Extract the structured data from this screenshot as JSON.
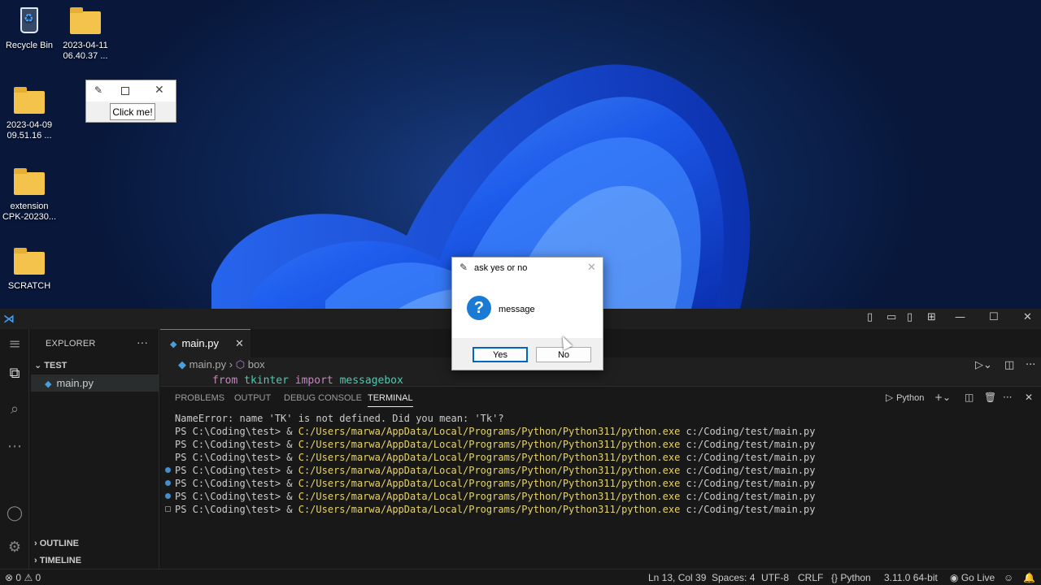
{
  "desktop": {
    "icons": [
      {
        "label": "Recycle Bin"
      },
      {
        "label": "2023-04-11 06.40.37 ..."
      },
      {
        "label": "2023-04-09 09.51.16 ..."
      },
      {
        "label": "extension CPK-20230..."
      },
      {
        "label": "SCRATCH"
      }
    ],
    "tk_window": {
      "button_label": "Click me!"
    }
  },
  "dialog": {
    "title": "ask yes or no",
    "message": "message",
    "yes_label": "Yes",
    "no_label": "No"
  },
  "vscode": {
    "sidebar": {
      "title": "EXPLORER",
      "folder": "TEST",
      "file": "main.py",
      "outline": "OUTLINE",
      "timeline": "TIMELINE"
    },
    "editor": {
      "tab": "main.py",
      "breadcrumb_file": "main.py",
      "breadcrumb_symbol": "box",
      "code_kw1": "from",
      "code_mod1": "tkinter",
      "code_kw2": "import",
      "code_mod2": "messagebox"
    },
    "panel": {
      "tabs": [
        "PROBLEMS",
        "OUTPUT",
        "DEBUG CONSOLE",
        "TERMINAL"
      ],
      "shell_label": "Python",
      "lines": [
        {
          "text": "NameError: name 'TK' is not defined. Did you mean: 'Tk'?"
        },
        {
          "prompt": "PS C:\\Coding\\test> & ",
          "path": "C:/Users/marwa/AppData/Local/Programs/Python/Python311/python.exe",
          "arg": " c:/Coding/test/main.py"
        },
        {
          "prompt": "PS C:\\Coding\\test> & ",
          "path": "C:/Users/marwa/AppData/Local/Programs/Python/Python311/python.exe",
          "arg": " c:/Coding/test/main.py"
        },
        {
          "prompt": "PS C:\\Coding\\test> & ",
          "path": "C:/Users/marwa/AppData/Local/Programs/Python/Python311/python.exe",
          "arg": " c:/Coding/test/main.py"
        },
        {
          "prompt": "PS C:\\Coding\\test> & ",
          "path": "C:/Users/marwa/AppData/Local/Programs/Python/Python311/python.exe",
          "arg": " c:/Coding/test/main.py"
        },
        {
          "prompt": "PS C:\\Coding\\test> & ",
          "path": "C:/Users/marwa/AppData/Local/Programs/Python/Python311/python.exe",
          "arg": " c:/Coding/test/main.py"
        },
        {
          "prompt": "PS C:\\Coding\\test> & ",
          "path": "C:/Users/marwa/AppData/Local/Programs/Python/Python311/python.exe",
          "arg": " c:/Coding/test/main.py"
        },
        {
          "prompt": "PS C:\\Coding\\test> & ",
          "path": "C:/Users/marwa/AppData/Local/Programs/Python/Python311/python.exe",
          "arg": " c:/Coding/test/main.py"
        }
      ]
    },
    "status": {
      "errors": "0",
      "warnings": "0",
      "position": "Ln 13, Col 39",
      "spaces": "Spaces: 4",
      "encoding": "UTF-8",
      "eol": "CRLF",
      "language": "Python",
      "interpreter": "3.11.0 64-bit",
      "golive": "Go Live"
    }
  }
}
